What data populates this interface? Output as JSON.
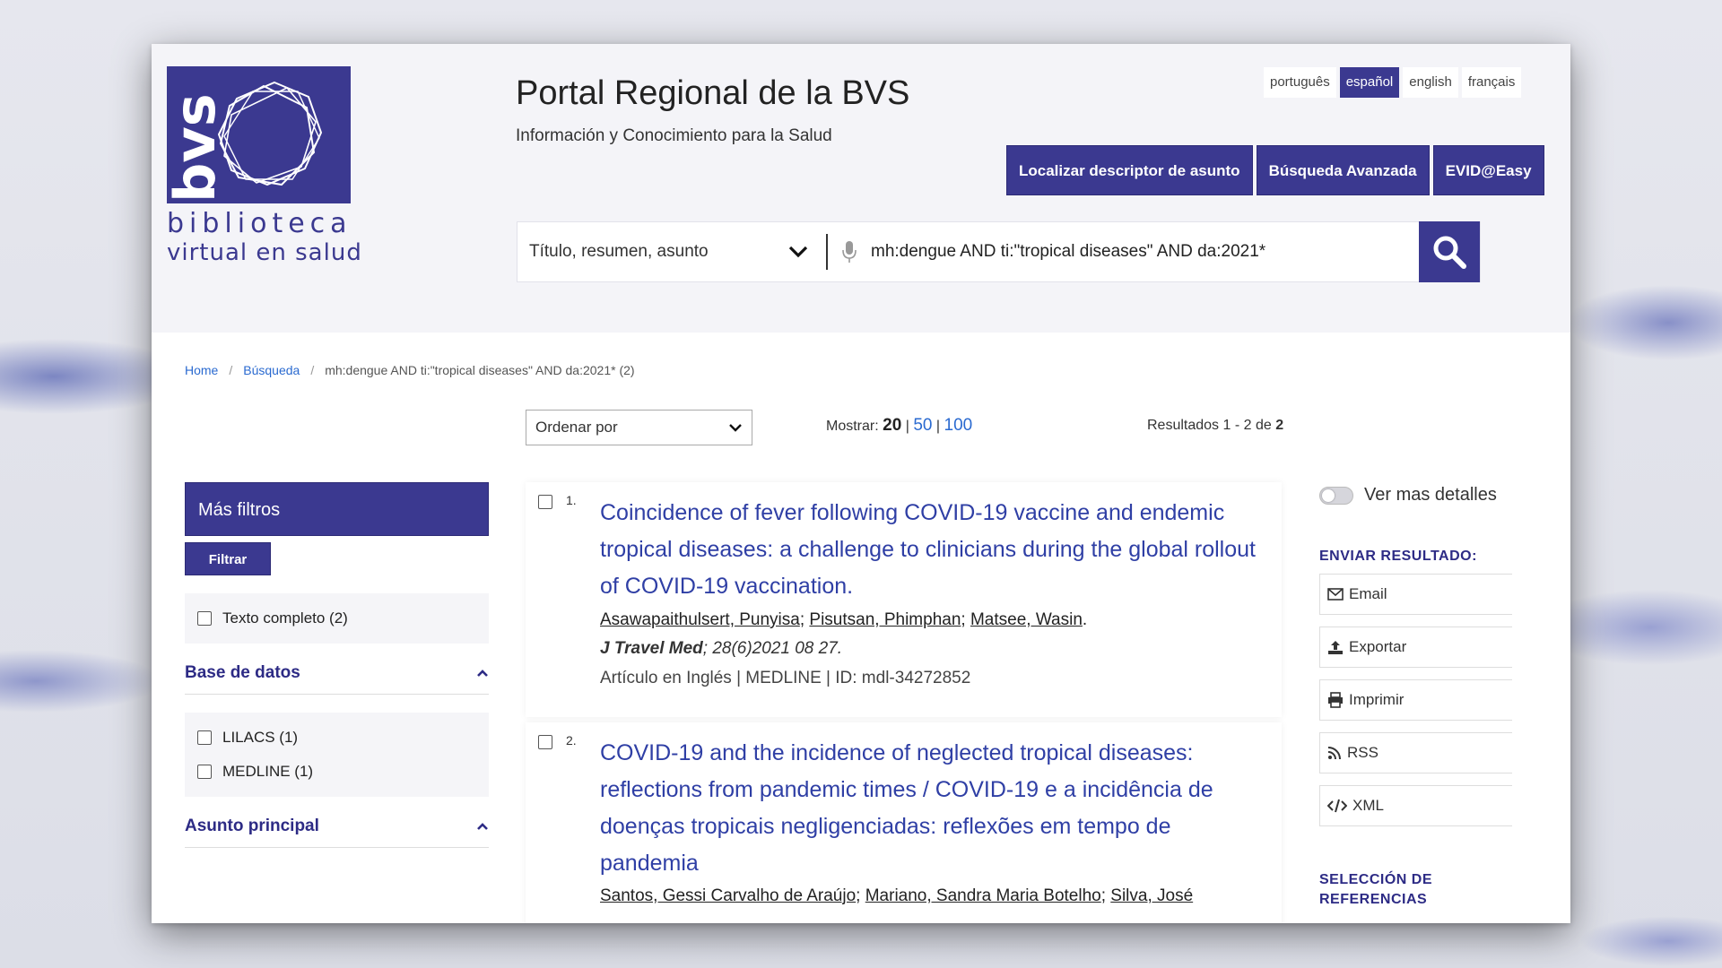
{
  "header": {
    "logo_vertical": "bvs",
    "logo_line1": "biblioteca",
    "logo_line2": "virtual en salud",
    "title": "Portal Regional de la BVS",
    "subtitle": "Información y Conocimiento para la Salud",
    "languages": [
      "português",
      "español",
      "english",
      "français"
    ],
    "active_language": "español",
    "nav_buttons": [
      "Localizar descriptor de asunto",
      "Búsqueda Avanzada",
      "EVID@Easy"
    ]
  },
  "search": {
    "field_selected": "Título, resumen, asunto",
    "query": "mh:dengue AND ti:\"tropical diseases\" AND da:2021*"
  },
  "breadcrumb": {
    "home": "Home",
    "search": "Búsqueda",
    "current": "mh:dengue AND ti:\"tropical diseases\" AND da:2021* (2)"
  },
  "toolbar": {
    "order_label": "Ordenar por",
    "show_label": "Mostrar:",
    "show_options": [
      "20",
      "50",
      "100"
    ],
    "results_label": "Resultados 1 - 2 de",
    "results_total": "2"
  },
  "sidebar": {
    "more_filters": "Más filtros",
    "filter_button": "Filtrar",
    "fulltext": "Texto completo (2)",
    "database_title": "Base de datos",
    "databases": [
      "LILACS (1)",
      "MEDLINE (1)"
    ],
    "subject_title": "Asunto principal"
  },
  "results": [
    {
      "num": "1.",
      "title": "Coincidence of fever following COVID-19 vaccine and endemic tropical diseases: a challenge to clinicians during the global rollout of COVID-19 vaccination.",
      "authors": [
        "Asawapaithulsert, Punyisa",
        "Pisutsan, Phimphan",
        "Matsee, Wasin"
      ],
      "journal_name": "J Travel Med",
      "journal_rest": "; 28(6)2021 08 27.",
      "meta": "Artículo en Inglés | MEDLINE | ID: mdl-34272852"
    },
    {
      "num": "2.",
      "title": "COVID-19 and the incidence of neglected tropical diseases: reflections from pandemic times / COVID-19 e a incidência de doenças tropicais negligenciadas: reflexões em tempo de pandemia",
      "authors": [
        "Santos, Gessi Carvalho de Araújo",
        "Mariano, Sandra Maria Botelho",
        "Silva, José"
      ]
    }
  ],
  "right": {
    "details_toggle": "Ver mas detalles",
    "send_title": "ENVIAR RESULTADO:",
    "send_items": [
      "Email",
      "Exportar",
      "Imprimir",
      "RSS",
      "XML"
    ],
    "selection_title": "SELECCIÓN DE REFERENCIAS"
  },
  "colors": {
    "brand": "#3b3990",
    "link": "#2f3fa5"
  }
}
